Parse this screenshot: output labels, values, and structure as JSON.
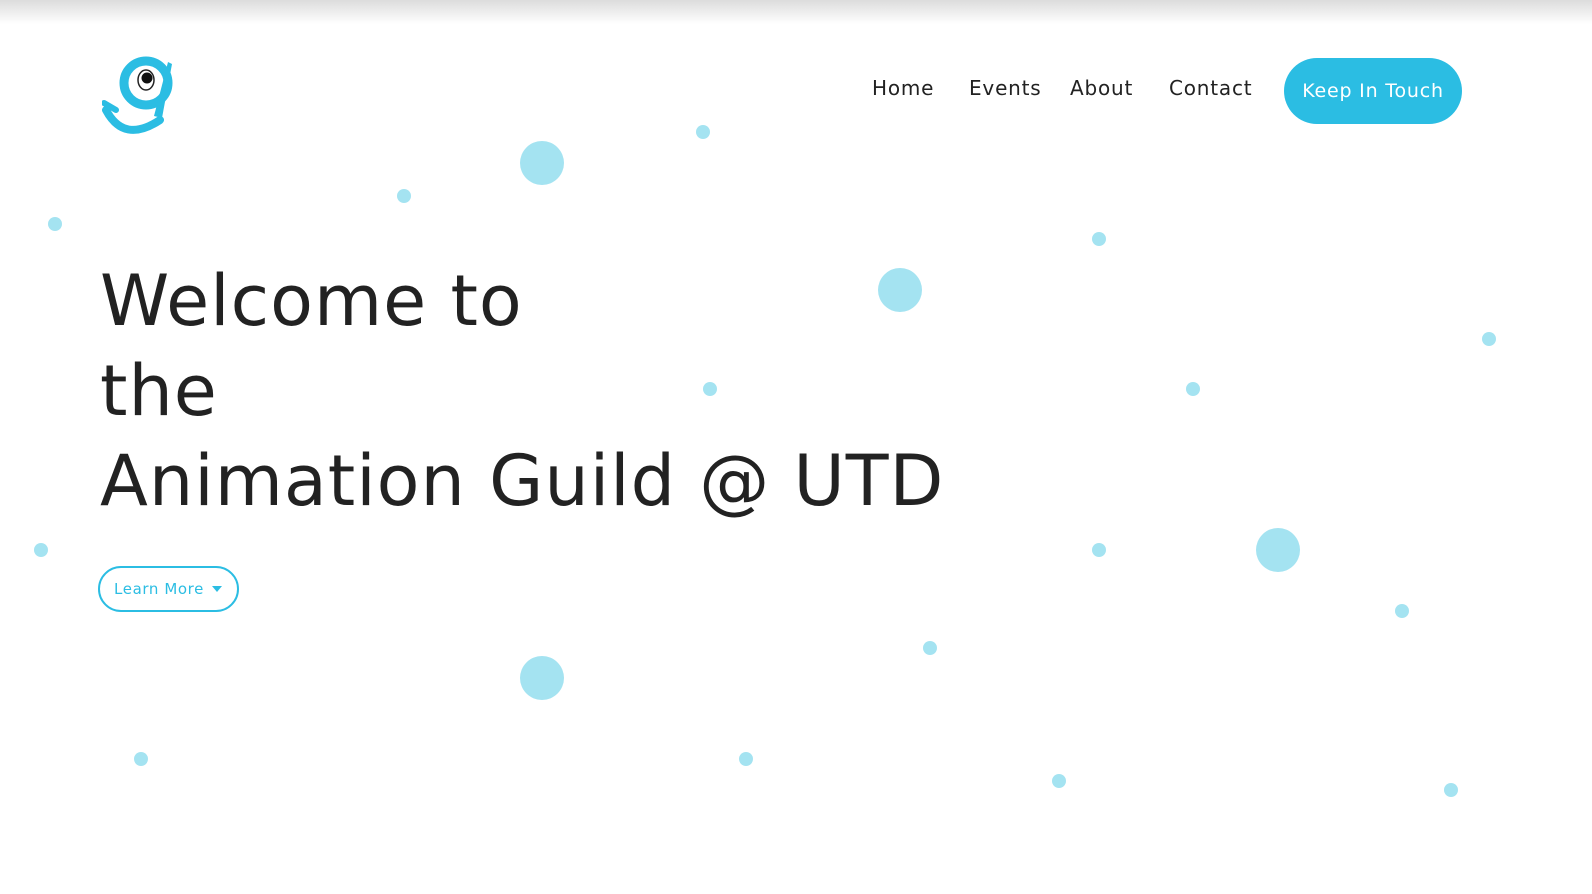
{
  "nav": {
    "items": [
      {
        "label": "Home"
      },
      {
        "label": "Events"
      },
      {
        "label": "About"
      },
      {
        "label": "Contact"
      }
    ],
    "cta_label": "Keep In Touch"
  },
  "hero": {
    "title_lines": [
      "Welcome to",
      "the",
      "Animation Guild @ UTD"
    ],
    "button_label": "Learn More",
    "button_icon": "caret-down-icon"
  },
  "logo": {
    "icon": "guild-logo-icon"
  },
  "colors": {
    "accent": "#2bbde3",
    "dots": "#a4e3f1",
    "text": "#222222",
    "background": "#ffffff"
  }
}
